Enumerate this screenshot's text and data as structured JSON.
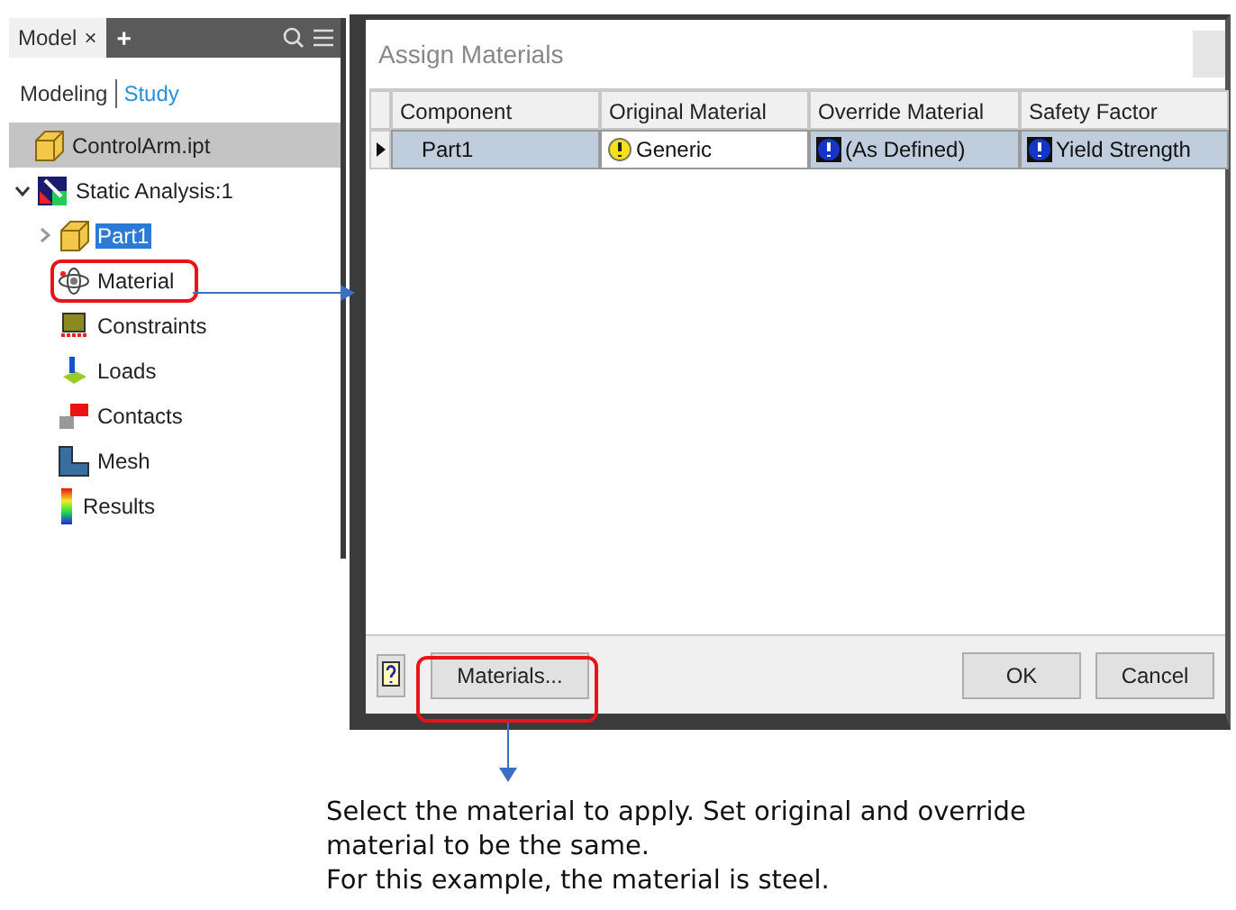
{
  "panel": {
    "tabs": [
      {
        "label": "Model",
        "close": "×",
        "selected": true
      }
    ],
    "add_tab": "+",
    "views": [
      {
        "label": "Modeling",
        "selected": false
      },
      {
        "label": "Study",
        "selected": true
      }
    ],
    "tree": [
      {
        "label": "ControlArm.ipt",
        "kind": "part",
        "selected": false,
        "highlight": true,
        "children": [
          {
            "label": "Static Analysis:1",
            "kind": "analysis",
            "expanded": true,
            "selected": false,
            "children": [
              {
                "label": "Part1",
                "kind": "part",
                "expanded": false,
                "selected": true
              },
              {
                "label": "Material",
                "kind": "material",
                "selected": false,
                "callout": true
              },
              {
                "label": "Constraints",
                "kind": "constraints",
                "selected": false
              },
              {
                "label": "Loads",
                "kind": "loads",
                "selected": false
              },
              {
                "label": "Contacts",
                "kind": "contacts",
                "selected": false
              },
              {
                "label": "Mesh",
                "kind": "mesh",
                "selected": false
              },
              {
                "label": "Results",
                "kind": "results",
                "selected": false
              }
            ]
          }
        ]
      }
    ]
  },
  "dialog": {
    "title": "Assign Materials",
    "columns": [
      "Component",
      "Original Material",
      "Override Material",
      "Safety Factor"
    ],
    "rows": [
      {
        "current": true,
        "cells": [
          {
            "text": "Part1",
            "editable": false
          },
          {
            "text": "Generic",
            "kind": "warning",
            "editable": true
          },
          {
            "text": "(As Defined)",
            "kind": "info",
            "editable": false
          },
          {
            "text": "Yield Strength",
            "kind": "info",
            "editable": false
          }
        ]
      }
    ],
    "materials_button": "Materials...",
    "ok_button": "OK",
    "cancel_button": "Cancel"
  },
  "caption": [
    "Select the material to apply. Set original and override",
    "material to be the same.",
    "For this example, the material is steel."
  ]
}
